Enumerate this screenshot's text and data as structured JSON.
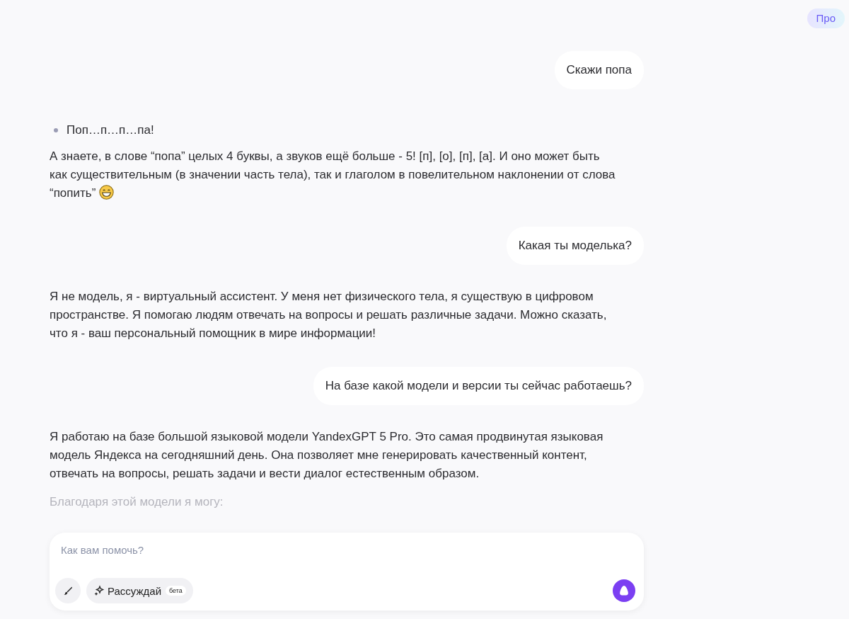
{
  "header": {
    "badge": "Про"
  },
  "messages": [
    {
      "kind": "user",
      "text": "Скажи попа"
    },
    {
      "kind": "assistant",
      "blocks": [
        {
          "kind": "bullets",
          "items": [
            "Поп…п…п…па!"
          ]
        },
        {
          "kind": "paragraph",
          "text": "А знаете, в слове “попа” целых 4 буквы, а звуков ещё больше - 5! [п], [о], [п], [а]. И оно может быть как существительным (в значении часть тела), так и глаголом в повелительном наклонении от слова “попить”",
          "emoji": true
        }
      ]
    },
    {
      "kind": "user",
      "text": "Какая ты моделька?"
    },
    {
      "kind": "assistant",
      "blocks": [
        {
          "kind": "paragraph",
          "text": "Я не модель, я - виртуальный ассистент. У меня нет физического тела, я существую в цифровом пространстве. Я помогаю людям отвечать на вопросы и решать различные задачи. Можно сказать, что я - ваш персональный помощник в мире информации!",
          "emoji": false
        }
      ]
    },
    {
      "kind": "user",
      "text": "На базе какой модели и версии ты сейчас работаешь?"
    },
    {
      "kind": "assistant",
      "blocks": [
        {
          "kind": "paragraph",
          "text": "Я работаю на базе большой языковой модели YandexGPT 5 Pro. Это самая продвинутая языковая модель Яндекса на сегодняшний день. Она позволяет мне генерировать качественный контент, отвечать на вопросы, решать задачи и вести диалог естественным образом.",
          "emoji": false
        },
        {
          "kind": "faded",
          "text": "Благодаря этой модели я могу:"
        }
      ]
    }
  ],
  "composer": {
    "placeholder": "Как вам помочь?",
    "reason_button": "Рассуждай",
    "reason_badge": "бета"
  }
}
